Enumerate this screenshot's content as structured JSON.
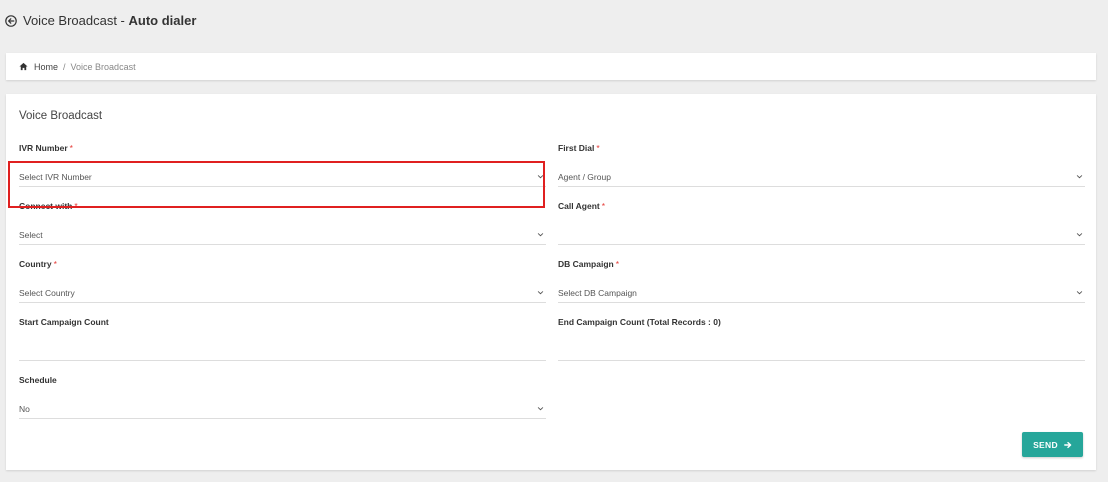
{
  "header": {
    "title_prefix": "Voice Broadcast - ",
    "title_strong": "Auto dialer",
    "back_icon": "arrow-left-circle-icon"
  },
  "breadcrumb": {
    "home": "Home",
    "separator": "/",
    "current": "Voice Broadcast"
  },
  "form": {
    "title": "Voice Broadcast",
    "required_marker": "*",
    "fields": {
      "ivr_number": {
        "label": "IVR Number",
        "value": "Select IVR Number"
      },
      "first_dial": {
        "label": "First Dial",
        "value": "Agent / Group"
      },
      "connect_with": {
        "label": "Connect with",
        "value": "Select"
      },
      "call_agent": {
        "label": "Call Agent",
        "value": ""
      },
      "country": {
        "label": "Country",
        "value": "Select Country"
      },
      "db_campaign": {
        "label": "DB Campaign",
        "value": "Select DB Campaign"
      },
      "start_campaign_count": {
        "label": "Start Campaign Count",
        "value": ""
      },
      "end_campaign_count": {
        "label": "End Campaign Count",
        "label_suffix": "(Total Records : 0)",
        "value": ""
      },
      "schedule": {
        "label": "Schedule",
        "value": "No"
      }
    },
    "send_label": "SEND"
  },
  "colors": {
    "accent": "#26a69a",
    "required": "#e53935",
    "highlight": "#e02020",
    "background": "#eeeeee"
  }
}
